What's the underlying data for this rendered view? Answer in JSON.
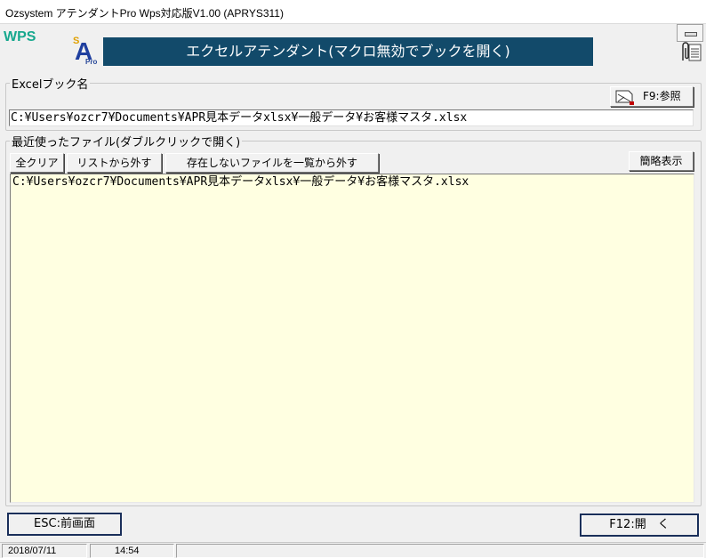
{
  "window": {
    "title": "Ozsystem アテンダントPro Wps対応版V1.00 (APRYS311)"
  },
  "header": {
    "wps_logo": "WPS",
    "sa_logo_s": "S",
    "sa_logo_a": "A",
    "sa_logo_pro": "Pro",
    "banner": "エクセルアテンダント(マクロ無効でブックを開く)"
  },
  "excel_book": {
    "legend": "Excelブック名",
    "browse_button": "F9:参照",
    "path_value": "C:¥Users¥ozcr7¥Documents¥APR見本データxlsx¥一般データ¥お客様マスタ.xlsx"
  },
  "recent": {
    "legend": "最近使ったファイル(ダブルクリックで開く)",
    "clear_all": "全クリア",
    "remove_from_list": "リストから外す",
    "remove_missing": "存在しないファイルを一覧から外す",
    "simple_view": "簡略表示",
    "items": [
      "C:¥Users¥ozcr7¥Documents¥APR見本データxlsx¥一般データ¥お客様マスタ.xlsx"
    ]
  },
  "footer": {
    "esc_button": "ESC:前画面",
    "f12_button": "F12:開　く"
  },
  "status": {
    "date": "2018/07/11",
    "time": "14:54"
  },
  "icons": {
    "browse": "open-folder-icon",
    "clip": "clip-icon"
  },
  "colors": {
    "banner_bg": "#124a6a",
    "list_bg": "#ffffe1",
    "wps_logo": "#17a88e"
  }
}
